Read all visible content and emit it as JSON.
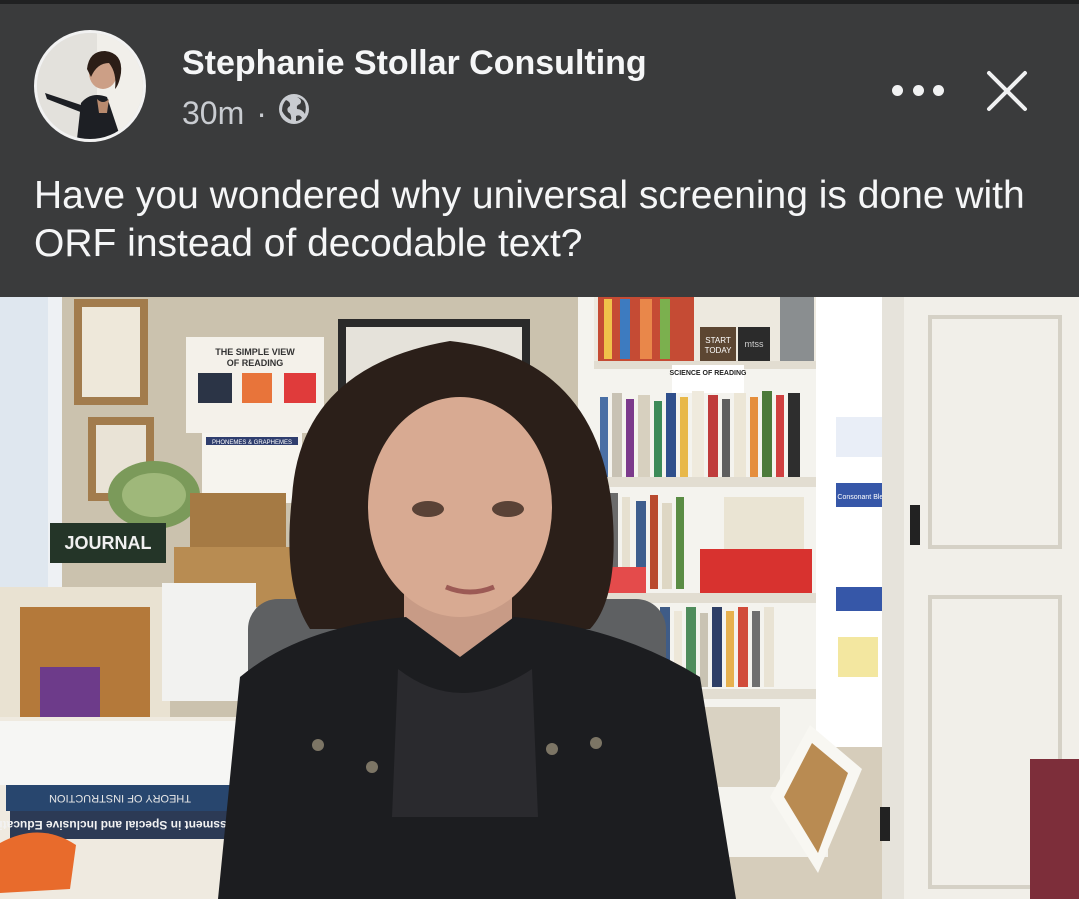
{
  "post": {
    "page_name": "Stephanie Stollar Consulting",
    "time": "30m",
    "separator": "·",
    "audience_icon": "globe-icon",
    "caption": "Have you wondered why universal screening is done with ORF instead of decodable text?"
  },
  "controls": {
    "more_icon": "more-dots-icon",
    "close_icon": "close-icon"
  },
  "video": {
    "poster_texts": {
      "simple_view": "THE SIMPLE VIEW OF READING",
      "start_today": "START TODAY",
      "science_of_reading": "SCIENCE OF READING",
      "journal": "JOURNAL",
      "mtss": "mtss",
      "phonemes": "PHONEMES & GRAPHEMES",
      "consonant_blends": "Consonant Blends"
    },
    "book_spines": {
      "assessment": "Assessment in Special and Inclusive Education",
      "theory": "THEORY OF INSTRUCTION"
    }
  },
  "colors": {
    "header_bg": "#3a3b3c",
    "text": "#f5f6f7",
    "meta_text": "#c9ccd1"
  }
}
